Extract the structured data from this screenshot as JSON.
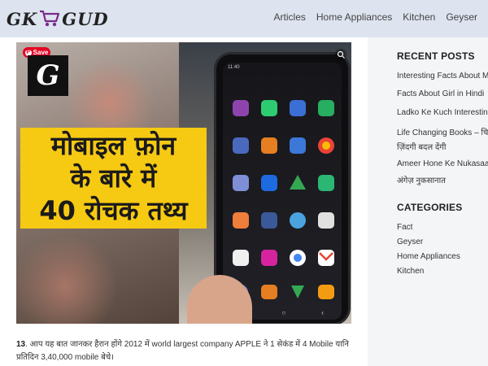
{
  "header": {
    "logo_left": "GK",
    "logo_right": "GUD",
    "nav": [
      "Articles",
      "Home Appliances",
      "Kitchen",
      "Geyser"
    ]
  },
  "hero": {
    "save_label": "Save",
    "badge_letter": "G",
    "headline_line1": "मोबाइल फ़ोन",
    "headline_line2": "के बारे में",
    "headline_line3": "40 रोचक तथ्य",
    "phone_status": "11:40"
  },
  "article": {
    "number": "13",
    "text": ". आप यह बात जानकर हैरान होंगे 2012 में world largest company APPLE ने 1 सेकंड में 4 Mobile यानि प्रतिदिन 3,40,000 mobile बेचे।"
  },
  "sidebar": {
    "recent_title": "RECENT POSTS",
    "recent_posts": [
      "Interesting Facts About Mo",
      "Facts About Girl in Hindi",
      "Ladko Ke Kuch Interesting",
      "Life Changing Books – चि",
      "ज़िंदगी बदल देंगी",
      "Ameer Hone Ke Nukasaan",
      "अंगेज़ नुकसानात"
    ],
    "categories_title": "CATEGORIES",
    "categories": [
      "Fact",
      "Geyser",
      "Home Appliances",
      "Kitchen"
    ]
  },
  "colors": {
    "header_bg": "#dde4ef",
    "headline_bg": "#f6c913",
    "pinterest_red": "#e60023"
  }
}
